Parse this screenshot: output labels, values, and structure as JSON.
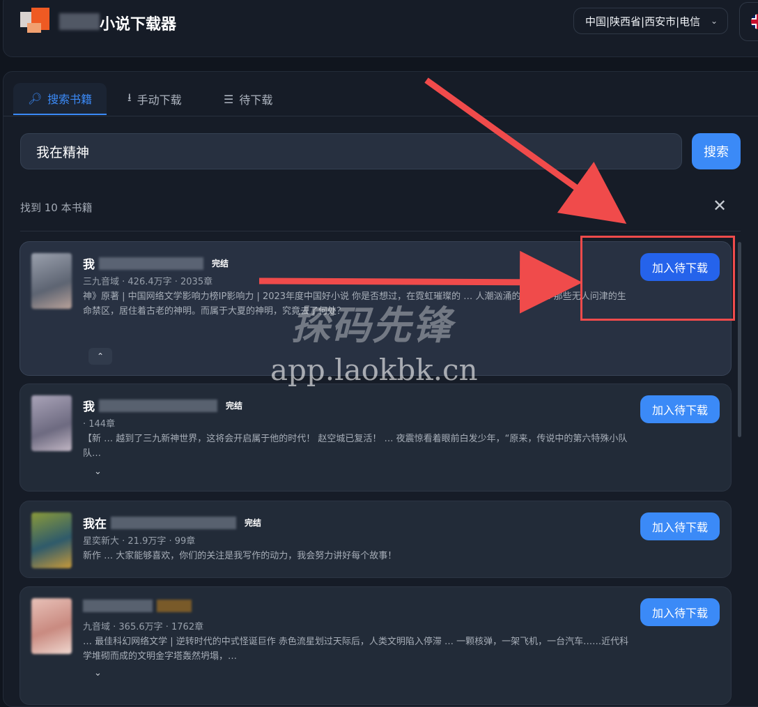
{
  "header": {
    "app_title": "小说下载器",
    "region": "中国|陕西省|西安市|电信",
    "language_icon": "uk-flag-icon"
  },
  "tabs": [
    {
      "label": "搜索书籍",
      "icon": "search-icon"
    },
    {
      "label": "手动下载",
      "icon": "download-icon"
    },
    {
      "label": "待下载",
      "icon": "list-icon"
    }
  ],
  "search": {
    "value": "我在精神",
    "button_label": "搜索"
  },
  "results": {
    "summary": "找到 10 本书籍"
  },
  "books": [
    {
      "title_prefix": "我",
      "status": "完结",
      "meta": "三九音域 · 426.4万字 · 2035章",
      "desc": "神》原著 | 中国网络文学影响力榜IP影响力 | 2023年度中国好小说 你是否想过，在霓虹璀璨的 … 人潮汹涌的现代 … 那些无人问津的生命禁区，居住着古老的神明。而属于大夏的神明，究竟去了何处？",
      "add_label": "加入待下载",
      "cover_color": "#8a8fa0"
    },
    {
      "title_prefix": "我",
      "status": "完结",
      "meta": "· 144章",
      "desc": "【新 … 越到了三九新神世界，这将会开启属于他的时代！ 赵空城已复活！ … 夜震惊看着眼前白发少年，“原来，传说中的第六特殊小队队…",
      "add_label": "加入待下载",
      "cover_color": "#9a8fa8"
    },
    {
      "title_prefix": "我在",
      "status": "完结",
      "meta": "星奕新大 · 21.9万字 · 99章",
      "desc": "新作 … 大家能够喜欢，你们的关注是我写作的动力，我会努力讲好每个故事！",
      "add_label": "加入待下载",
      "cover_color": "#5b7a4a"
    },
    {
      "title_prefix": "",
      "status": "",
      "meta": "九音域 · 365.6万字 · 1762章",
      "desc": "… 最佳科幻网络文学 | 逆转时代的中式怪诞巨作 赤色流星划过天际后，人类文明陷入停滞 … 一颗核弹，一架飞机，一台汽车……近代科学堆砌而成的文明金字塔轰然坍塌，…",
      "add_label": "加入待下载",
      "cover_color": "#d9a9a0"
    }
  ],
  "watermark": {
    "brand": "探码先锋",
    "url": "app.laokbk.cn"
  },
  "colors": {
    "accent": "#3b8af7",
    "annotation": "#f04b4b"
  }
}
